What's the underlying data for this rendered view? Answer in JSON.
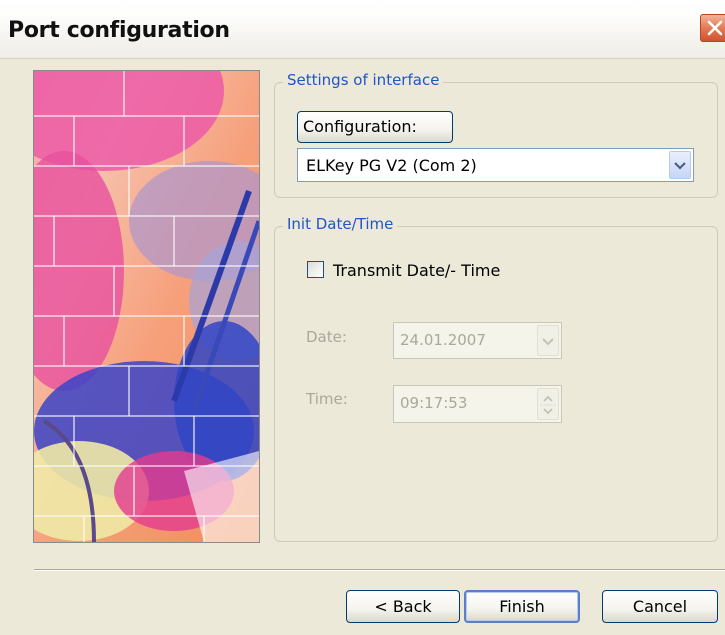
{
  "window": {
    "title": "Port configuration",
    "close_icon": "close-icon"
  },
  "interface_group": {
    "label": "Settings of interface",
    "config_button_label": "Configuration:",
    "port_select_value": "ELKey PG V2 (Com 2)"
  },
  "datetime_group": {
    "label": "Init Date/Time",
    "transmit_label": "Transmit Date/- Time",
    "transmit_checked": false,
    "date_label": "Date:",
    "date_value": "24.01.2007",
    "time_label": "Time:",
    "time_value": "09:17:53"
  },
  "footer": {
    "back_label": "< Back",
    "finish_label": "Finish",
    "cancel_label": "Cancel"
  },
  "colors": {
    "dialog_bg": "#ece9d8",
    "group_label": "#1f55c8",
    "close_button": "#e2754f"
  }
}
